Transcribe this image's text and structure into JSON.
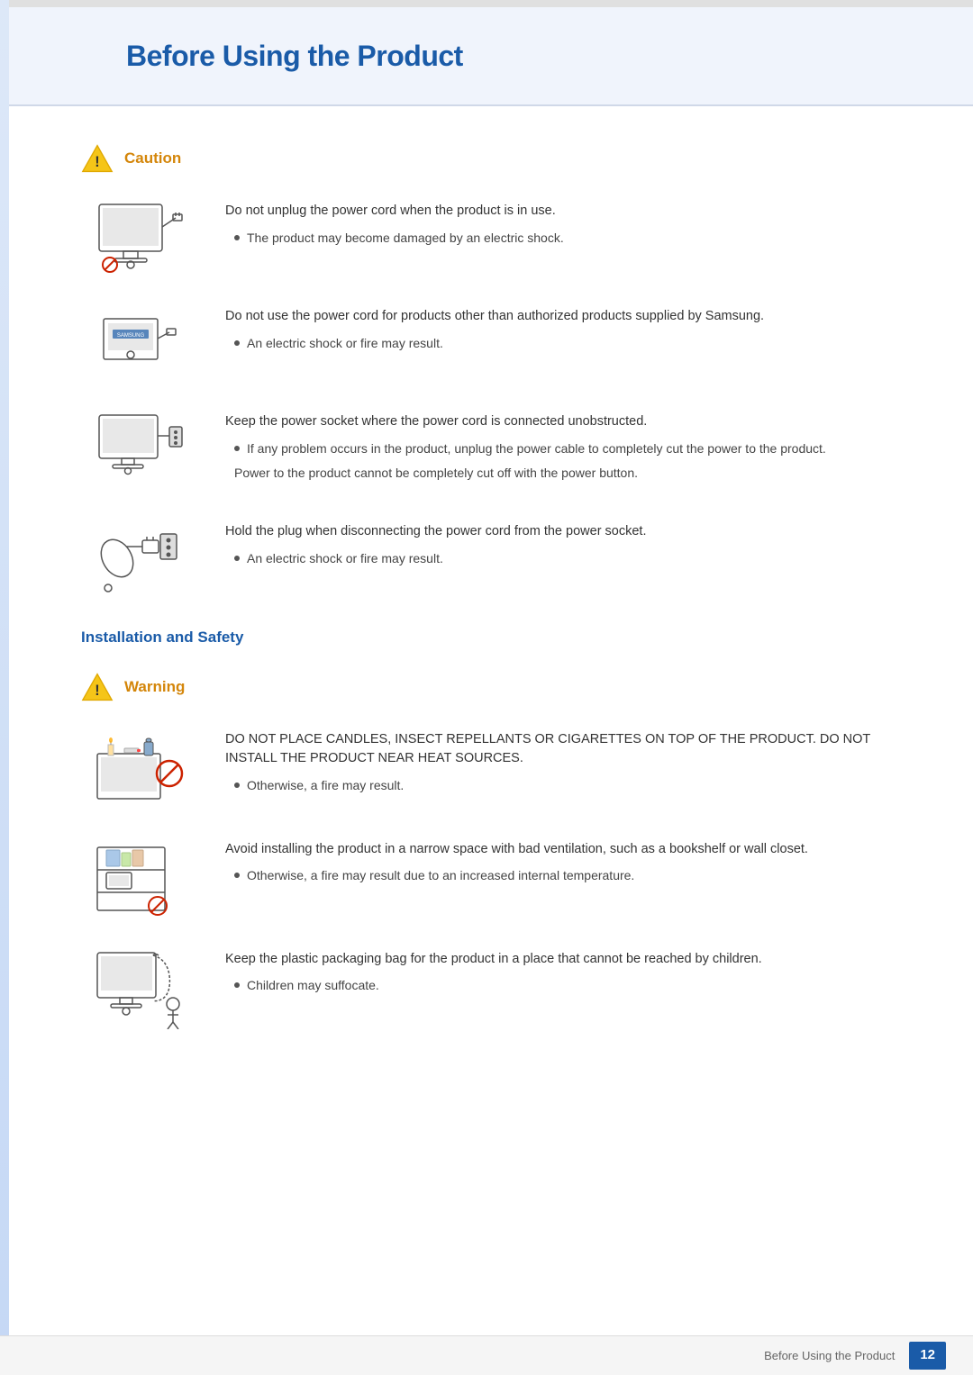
{
  "page": {
    "title": "Before Using the Product",
    "page_number": "12",
    "footer_label": "Before Using the Product"
  },
  "caution_section": {
    "label": "Caution",
    "items": [
      {
        "main_text": "Do not unplug the power cord when the product is in use.",
        "bullet": "The product may become damaged by an electric shock.",
        "sub_text": null
      },
      {
        "main_text": "Do not use the power cord for products other than authorized products supplied by Samsung.",
        "bullet": "An electric shock or fire may result.",
        "sub_text": null
      },
      {
        "main_text": "Keep the power socket where the power cord is connected unobstructed.",
        "bullet": "If any problem occurs in the product, unplug the power cable to completely cut the power to the product.",
        "sub_text": "Power to the product cannot be completely cut off with the power button."
      },
      {
        "main_text": "Hold the plug when disconnecting the power cord from the power socket.",
        "bullet": "An electric shock or fire may result.",
        "sub_text": null
      }
    ]
  },
  "installation_section": {
    "label": "Installation and Safety"
  },
  "warning_section": {
    "label": "Warning",
    "items": [
      {
        "main_text": "DO NOT PLACE CANDLES, INSECT REPELLANTS OR CIGARETTES ON TOP OF THE PRODUCT. DO NOT INSTALL THE PRODUCT NEAR HEAT SOURCES.",
        "bullet": "Otherwise, a fire may result.",
        "sub_text": null
      },
      {
        "main_text": "Avoid installing the product in a narrow space with bad ventilation, such as a bookshelf or wall closet.",
        "bullet": "Otherwise, a fire may result due to an increased internal temperature.",
        "sub_text": null
      },
      {
        "main_text": "Keep the plastic packaging bag for the product in a place that cannot be reached by children.",
        "bullet": "Children may suffocate.",
        "sub_text": null
      }
    ]
  }
}
